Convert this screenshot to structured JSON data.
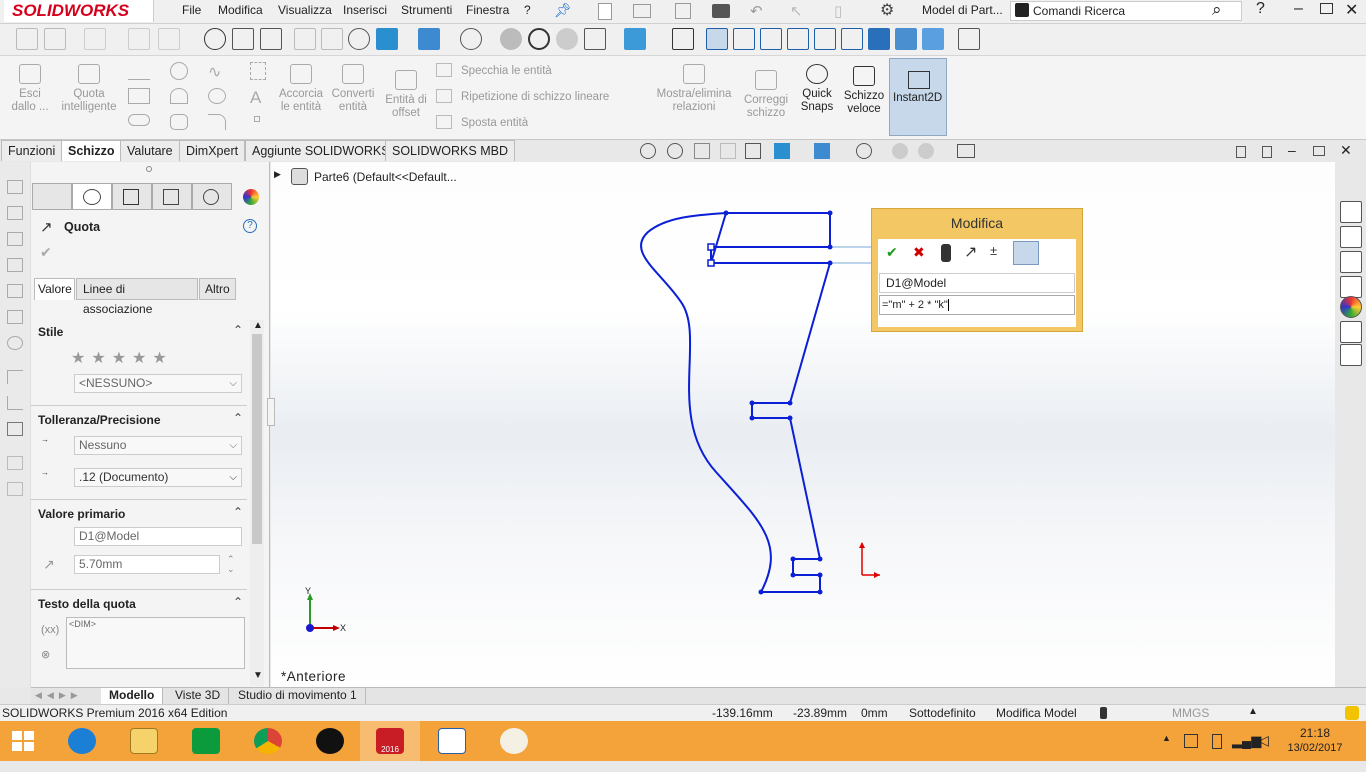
{
  "titlebar": {
    "brand": "SOLIDWORKS",
    "menus": [
      "File",
      "Modifica",
      "Visualizza",
      "Inserisci",
      "Strumenti",
      "Finestra",
      "?"
    ],
    "document": "Model di Part...",
    "search_label": "Comandi Ricerca"
  },
  "ribbon": {
    "items": [
      "Esci dallo ...",
      "Quota intelligente",
      "Accorcia le entità",
      "Converti entità",
      "Entità di offset",
      "Specchia le entità",
      "Ripetizione di schizzo lineare",
      "Sposta entità",
      "Mostra/elimina relazioni",
      "Correggi schizzo",
      "Quick Snaps",
      "Schizzo veloce",
      "Instant2D"
    ]
  },
  "tabs": [
    "Funzioni",
    "Schizzo",
    "Valutare",
    "DimXpert",
    "Aggiunte SOLIDWORKS",
    "SOLIDWORKS MBD"
  ],
  "active_tab": "Schizzo",
  "panel": {
    "title": "Quota",
    "subtabs": [
      "Valore",
      "Linee di associazione",
      "Altro"
    ],
    "stile": {
      "header": "Stile",
      "dropdown": "<NESSUNO>"
    },
    "tolleranza": {
      "header": "Tolleranza/Precisione",
      "tolerance": "Nessuno",
      "precision": ".12 (Documento)"
    },
    "valore_primario": {
      "header": "Valore primario",
      "name": "D1@Model",
      "value": "5.70mm"
    },
    "testo": {
      "header": "Testo della quota",
      "text": "<DIM>"
    }
  },
  "tree": {
    "node": "Parte6  (Default<<Default..."
  },
  "viewport": {
    "view_label": "*Anteriore",
    "axis_x": "X",
    "axis_y": "Y"
  },
  "modifica": {
    "title": "Modifica",
    "name": "D1@Model",
    "expression": "=\"m\" + 2 * \"k\""
  },
  "bottom_tabs": [
    "Modello",
    "Viste 3D",
    "Studio di movimento 1"
  ],
  "status": {
    "edition": "SOLIDWORKS Premium 2016 x64 Edition",
    "x": "-139.16mm",
    "y": "-23.89mm",
    "z": "0mm",
    "state": "Sottodefinito",
    "mode": "Modifica Model",
    "units": "MMGS"
  },
  "taskbar": {
    "time": "21:18",
    "date": "13/02/2017",
    "sw_badge": "2016"
  },
  "colors": {
    "sketch": "#0a1fd6",
    "taskbar": "#f4a23a",
    "dialog": "#f3c764",
    "brand": "#d6001c"
  }
}
